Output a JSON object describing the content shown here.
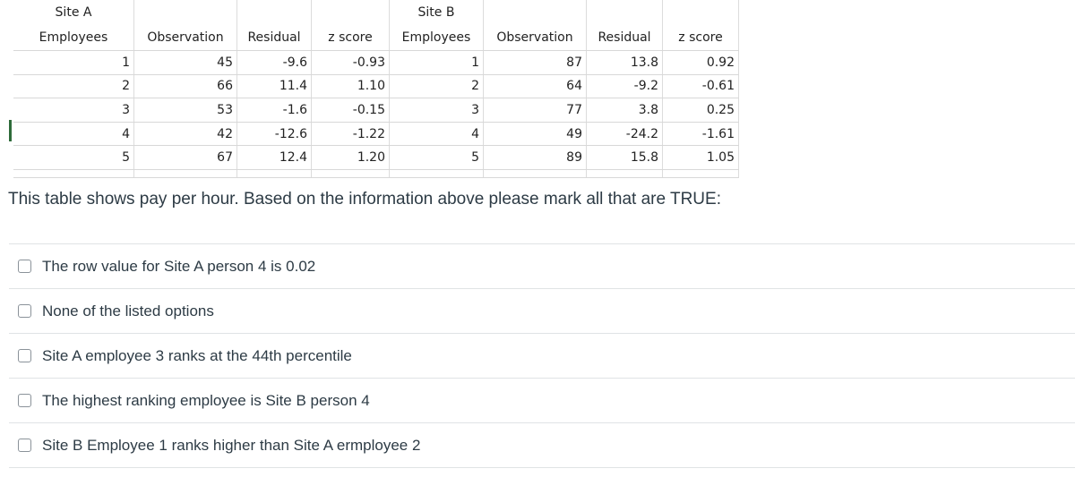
{
  "table": {
    "site_a_label": "Site A",
    "site_b_label": "Site B",
    "headers": [
      "Employees",
      "Observation",
      "Residual",
      "z score",
      "Employees",
      "Observation",
      "Residual",
      "z score"
    ],
    "rows": [
      [
        "1",
        "45",
        "-9.6",
        "-0.93",
        "1",
        "87",
        "13.8",
        "0.92"
      ],
      [
        "2",
        "66",
        "11.4",
        "1.10",
        "2",
        "64",
        "-9.2",
        "-0.61"
      ],
      [
        "3",
        "53",
        "-1.6",
        "-0.15",
        "3",
        "77",
        "3.8",
        "0.25"
      ],
      [
        "4",
        "42",
        "-12.6",
        "-1.22",
        "4",
        "49",
        "-24.2",
        "-1.61"
      ],
      [
        "5",
        "67",
        "12.4",
        "1.20",
        "5",
        "89",
        "15.8",
        "1.05"
      ]
    ]
  },
  "question": "This table shows pay per hour. Based on the information above please mark all that are TRUE:",
  "options": [
    "The row value for Site A person 4 is 0.02",
    "None of the listed options",
    "Site A employee 3 ranks at the 44th percentile",
    "The highest ranking employee is Site B person 4",
    "Site B Employee 1 ranks higher than Site A ermployee 2"
  ]
}
